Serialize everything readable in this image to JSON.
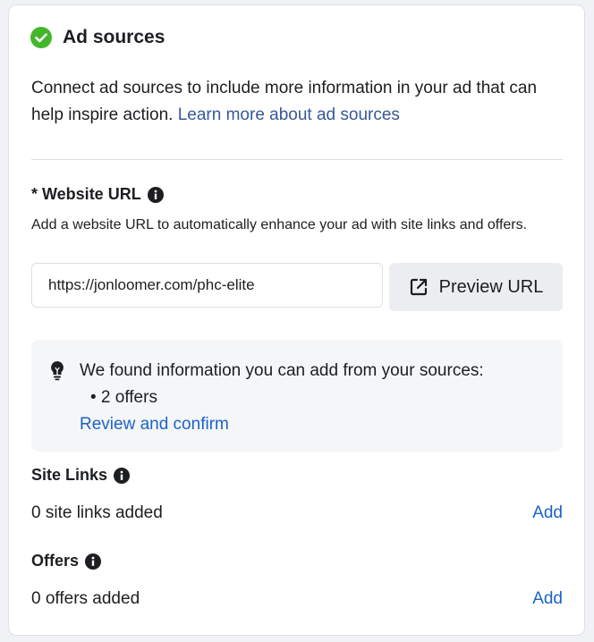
{
  "section": {
    "title": "Ad sources",
    "status_icon": "check-circle-icon",
    "status_color": "#42b72a"
  },
  "intro": {
    "text": "Connect ad sources to include more information in your ad that can help inspire action. ",
    "link": "Learn more about ad sources"
  },
  "website_url": {
    "label": "* Website URL",
    "help": "Add a website URL to automatically enhance your ad with site links and offers.",
    "value": "https://jonloomer.com/phc-elite",
    "preview_label": "Preview URL"
  },
  "tip": {
    "text": "We found information you can add from your sources:",
    "bullet": "• 2 offers",
    "link": "Review and confirm"
  },
  "site_links": {
    "label": "Site Links",
    "status": "0 site links added",
    "add_label": "Add"
  },
  "offers": {
    "label": "Offers",
    "status": "0 offers added",
    "add_label": "Add"
  },
  "colors": {
    "link_primary": "#1a63c8",
    "link_dark": "#385898",
    "text": "#1c1e21"
  }
}
